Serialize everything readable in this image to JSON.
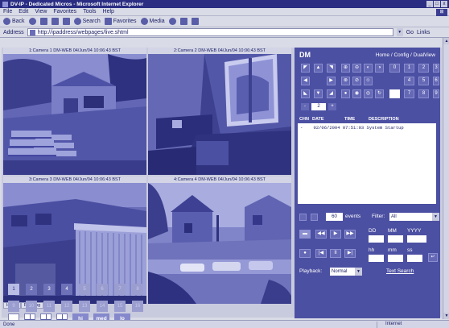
{
  "window": {
    "title": "DV-IP - Dedicated Micros - Microsoft Internet Explorer",
    "controls": [
      "_",
      "□",
      "x"
    ]
  },
  "menu": [
    "File",
    "Edit",
    "View",
    "Favorites",
    "Tools",
    "Help"
  ],
  "toolbar": {
    "back": "Back",
    "search": "Search",
    "favorites": "Favorites",
    "media": "Media"
  },
  "address": {
    "label": "Address",
    "url": "http://ipaddress/webpages/live.shtml",
    "go": "Go",
    "links": "Links"
  },
  "cameras": [
    {
      "caption": "1:Camera 1 DM-WEB 04/Jun/04 10:06:43 BST"
    },
    {
      "caption": "2:Camera 2 DM-WEB 04/Jun/04 10:06:43 BST"
    },
    {
      "caption": "3:Camera 3 DM-WEB 04/Jun/04 10:06:43 BST"
    },
    {
      "caption": "4:Camera 4 DM-WEB 04/Jun/04 10:06:43 BST"
    }
  ],
  "view_tabs": [
    "HIGH",
    "Running"
  ],
  "quality": [
    "hi",
    "med",
    "lo"
  ],
  "camera_numbers": [
    "1",
    "2",
    "3",
    "4",
    "5",
    "6",
    "7",
    "8",
    "9",
    "10",
    "11",
    "12",
    "13",
    "14",
    "15",
    "16"
  ],
  "panel": {
    "brand": "DM",
    "breadcrumb": "Home / Config / DualView",
    "step_minus": "-",
    "step_value": "2",
    "step_plus": "+",
    "keypad": [
      "0",
      "1",
      "2",
      "3",
      "4",
      "5",
      "6",
      "7",
      "8",
      "9"
    ],
    "log_columns": [
      "CHN",
      "DATE",
      "TIME",
      "DESCRIPTION"
    ],
    "log_rows": [
      {
        "chn": "-",
        "entry": "02/06/2004 07:51:03 System Startup"
      }
    ],
    "events_count": "60",
    "events_label": "events",
    "filter_label": "Filter:",
    "filter_value": "All",
    "date_labels": [
      "DD",
      "MM",
      "YYYY"
    ],
    "time_labels": [
      "hh",
      "mm",
      "ss"
    ],
    "playback_label": "Playback:",
    "playback_value": "Normal",
    "text_search": "Text Search"
  },
  "status": {
    "left": "Done",
    "zone": "Internet"
  }
}
